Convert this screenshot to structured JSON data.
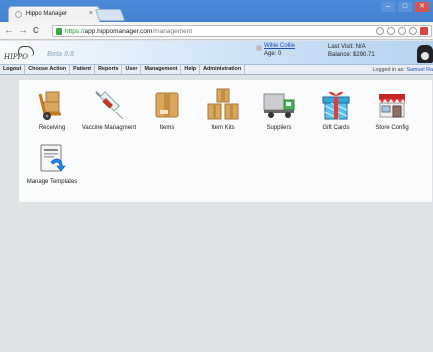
{
  "browser": {
    "tab_title": "Hippo Manager",
    "tab_close": "×",
    "url_scheme": "https://",
    "url_host": "app.hippomanager.com",
    "url_path": "/management",
    "win_min": "–",
    "win_max": "□",
    "win_close": "✕",
    "back": "←",
    "forward": "→",
    "reload": "C"
  },
  "header": {
    "logo_text": "HIPPO",
    "beta_label": "Beta 0.8",
    "patient_name": "Willie Collie",
    "patient_age": "Age: 0",
    "last_visit": "Last Visit: N/A",
    "balance": "Balance: $290.71"
  },
  "menu": {
    "items": [
      "Logout",
      "Choose Action",
      "Patient",
      "Reports",
      "User",
      "Management",
      "Help",
      "Administration"
    ],
    "logged_in_prefix": "Logged in as: ",
    "logged_in_user": "Samuel Ra"
  },
  "tiles": [
    {
      "label": "Receiving",
      "icon": "hand-truck-icon"
    },
    {
      "label": "Vaccine Managment",
      "icon": "syringe-icon"
    },
    {
      "label": "Items",
      "icon": "box-icon"
    },
    {
      "label": "Item Kits",
      "icon": "stacked-boxes-icon"
    },
    {
      "label": "Suppliers",
      "icon": "delivery-truck-icon"
    },
    {
      "label": "Gift Cards",
      "icon": "gift-icon"
    },
    {
      "label": "Store Config",
      "icon": "storefront-icon"
    },
    {
      "label": "Manage Templates",
      "icon": "template-icon"
    }
  ],
  "colors": {
    "accent": "#3d7bc9",
    "link": "#1f4fb8"
  }
}
